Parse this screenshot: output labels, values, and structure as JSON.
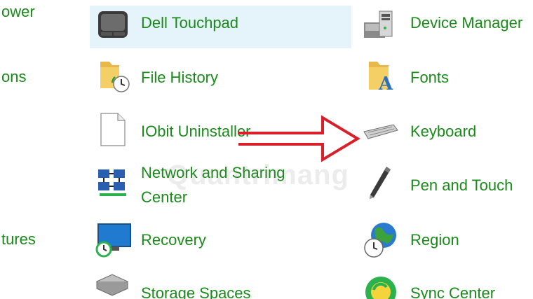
{
  "left_column_partial": [
    {
      "label": "ower"
    },
    {
      "label": "ons"
    },
    {
      "label": "tures"
    }
  ],
  "items": [
    {
      "label": "Dell Touchpad",
      "icon": "touchpad-icon",
      "highlighted": true
    },
    {
      "label": "Device Manager",
      "icon": "device-manager-icon"
    },
    {
      "label": "File History",
      "icon": "file-history-icon"
    },
    {
      "label": "Fonts",
      "icon": "fonts-folder-icon"
    },
    {
      "label": "IObit Uninstaller",
      "icon": "blank-document-icon"
    },
    {
      "label": "Keyboard",
      "icon": "keyboard-icon"
    },
    {
      "label": "Network and Sharing Center",
      "icon": "network-icon"
    },
    {
      "label": "Pen and Touch",
      "icon": "pen-icon"
    },
    {
      "label": "Recovery",
      "icon": "recovery-icon"
    },
    {
      "label": "Region",
      "icon": "globe-clock-icon"
    },
    {
      "label": "Storage Spaces",
      "icon": "storage-icon"
    },
    {
      "label": "Sync Center",
      "icon": "sync-icon"
    }
  ],
  "network_label_line1": "Network and Sharing",
  "network_label_line2": "Center",
  "watermark": "Quantrimang",
  "colors": {
    "link": "#1a8a1a",
    "highlight": "#e5f3fb",
    "arrow": "#d9202a"
  }
}
